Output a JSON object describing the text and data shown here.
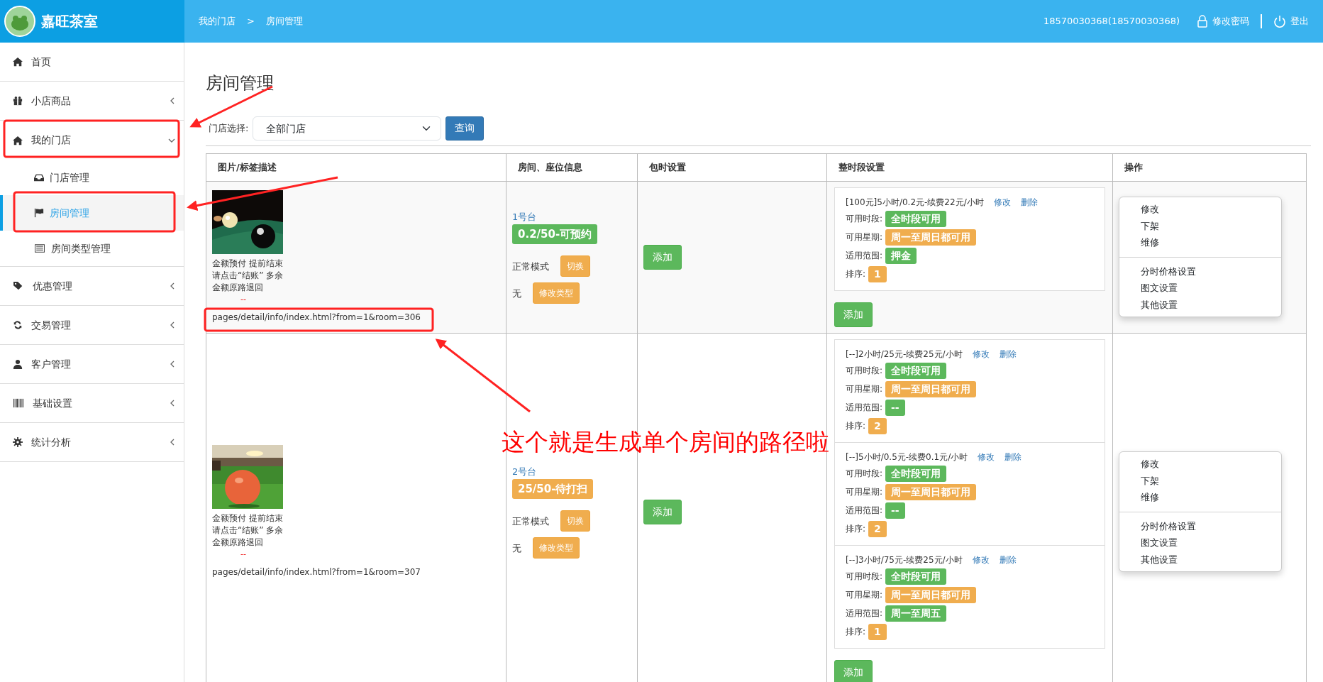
{
  "header": {
    "brand": "嘉旺茶室",
    "breadcrumb": [
      "我的门店",
      "房间管理"
    ],
    "breadcrumb_separator": ">",
    "user": "18570030368(18570030368)",
    "change_password": "修改密码",
    "logout": "登出"
  },
  "sidebar": {
    "items": [
      {
        "label": "首页"
      },
      {
        "label": "小店商品",
        "expanded": false
      },
      {
        "label": "我的门店",
        "expanded": true,
        "children": [
          {
            "label": "门店管理",
            "selected": false
          },
          {
            "label": "房间管理",
            "selected": true
          },
          {
            "label": "房间类型管理",
            "selected": false
          }
        ]
      },
      {
        "label": "优惠管理",
        "expanded": false
      },
      {
        "label": "交易管理",
        "expanded": false
      },
      {
        "label": "客户管理",
        "expanded": false
      },
      {
        "label": "基础设置",
        "expanded": false
      },
      {
        "label": "统计分析",
        "expanded": false
      }
    ]
  },
  "page_title": "房间管理",
  "filter": {
    "label": "门店选择:",
    "value": "全部门店",
    "button": "查询"
  },
  "table": {
    "columns": [
      "图片/标签描述",
      "房间、座位信息",
      "包时设置",
      "整时段设置",
      "操作"
    ],
    "rows": [
      {
        "picture": {
          "kind": "picture"
        },
        "description": "金额预付 提前结束请点击“结账” 多余金额原路退回",
        "mark": "--",
        "path": "pages/detail/info/index.html?from=1&room=306",
        "room_name": "1号台",
        "status": {
          "text": "0.2/50-可预约",
          "color": "#5cb85c"
        },
        "mode": "正常模式",
        "switch_button": "切换",
        "type": "无",
        "type_button": "修改类型",
        "package_button": "添加",
        "periods": [
          {
            "title": "[100元]5小时/0.2元-续费22元/小时",
            "edit": "修改",
            "delete": "删除",
            "fields": [
              {
                "label": "可用时段:",
                "value": "全时段可用",
                "color": "#5cb85c"
              },
              {
                "label": "可用星期:",
                "value": "周一至周日都可用",
                "color": "#f0ad4e"
              },
              {
                "label": "适用范围:",
                "value": "押金",
                "color": "#5cb85c"
              },
              {
                "label": "排序:",
                "value": "1",
                "color": "#f0ad4e"
              }
            ]
          }
        ],
        "period_button": "添加",
        "menu": [
          [
            "修改",
            "下架",
            "维修"
          ],
          [
            "分时价格设置",
            "图文设置",
            "其他设置"
          ]
        ]
      },
      {
        "picture": {
          "kind": "picture"
        },
        "description": "金额预付 提前结束请点击“结账” 多余金额原路退回",
        "mark": "--",
        "path": "pages/detail/info/index.html?from=1&room=307",
        "room_name": "2号台",
        "status": {
          "text": "25/50-待打扫",
          "color": "#f0ad4e"
        },
        "mode": "正常模式",
        "switch_button": "切换",
        "type": "无",
        "type_button": "修改类型",
        "package_button": "添加",
        "periods": [
          {
            "title": "[--]2小时/25元-续费25元/小时",
            "edit": "修改",
            "delete": "删除",
            "fields": [
              {
                "label": "可用时段:",
                "value": "全时段可用",
                "color": "#5cb85c"
              },
              {
                "label": "可用星期:",
                "value": "周一至周日都可用",
                "color": "#f0ad4e"
              },
              {
                "label": "适用范围:",
                "value": "--",
                "color": "#5cb85c"
              },
              {
                "label": "排序:",
                "value": "2",
                "color": "#f0ad4e"
              }
            ]
          },
          {
            "title": "[--]5小时/0.5元-续费0.1元/小时",
            "edit": "修改",
            "delete": "删除",
            "fields": [
              {
                "label": "可用时段:",
                "value": "全时段可用",
                "color": "#5cb85c"
              },
              {
                "label": "可用星期:",
                "value": "周一至周日都可用",
                "color": "#f0ad4e"
              },
              {
                "label": "适用范围:",
                "value": "--",
                "color": "#5cb85c"
              },
              {
                "label": "排序:",
                "value": "2",
                "color": "#f0ad4e"
              }
            ]
          },
          {
            "title": "[--]3小时/75元-续费25元/小时",
            "edit": "修改",
            "delete": "删除",
            "fields": [
              {
                "label": "可用时段:",
                "value": "全时段可用",
                "color": "#5cb85c"
              },
              {
                "label": "可用星期:",
                "value": "周一至周日都可用",
                "color": "#f0ad4e"
              },
              {
                "label": "适用范围:",
                "value": "周一至周五",
                "color": "#5cb85c"
              },
              {
                "label": "排序:",
                "value": "1",
                "color": "#f0ad4e"
              }
            ]
          }
        ],
        "period_button": "添加",
        "menu": [
          [
            "修改",
            "下架",
            "维修"
          ],
          [
            "分时价格设置",
            "图文设置",
            "其他设置"
          ]
        ]
      }
    ]
  },
  "annotation": {
    "text": "这个就是生成单个房间的路径啦"
  }
}
